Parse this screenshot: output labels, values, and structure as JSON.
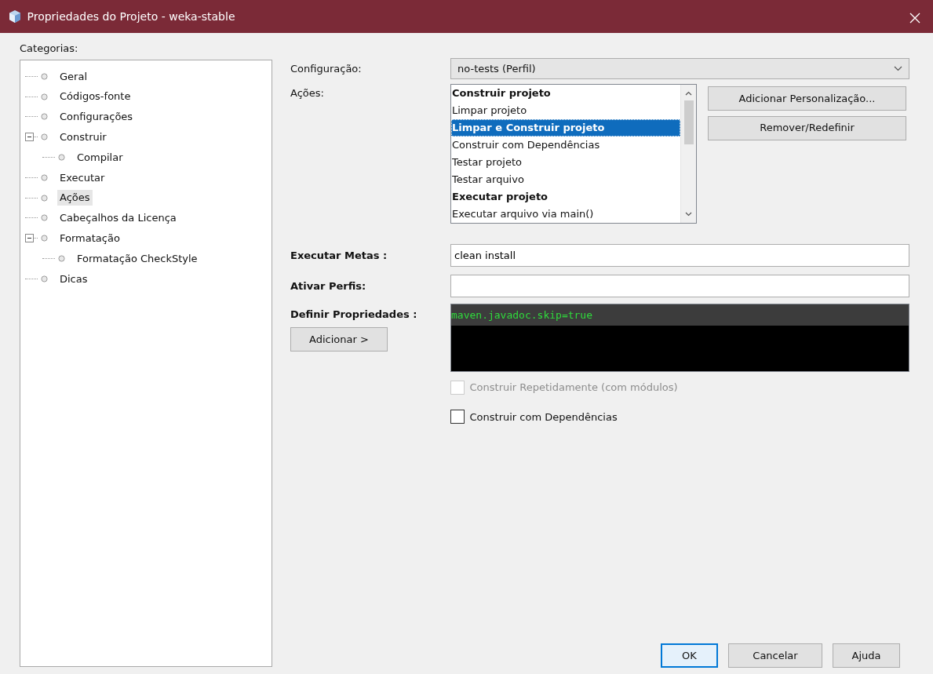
{
  "window": {
    "title": "Propriedades do Projeto - weka-stable"
  },
  "categories": {
    "label": "Categorias:",
    "items": [
      {
        "label": "Geral",
        "selected": false
      },
      {
        "label": "Códigos-fonte",
        "selected": false
      },
      {
        "label": "Configurações",
        "selected": false
      },
      {
        "label": "Construir",
        "selected": false,
        "expanded": true,
        "children": [
          {
            "label": "Compilar",
            "selected": false
          }
        ]
      },
      {
        "label": "Executar",
        "selected": false
      },
      {
        "label": "Ações",
        "selected": true
      },
      {
        "label": "Cabeçalhos da Licença",
        "selected": false
      },
      {
        "label": "Formatação",
        "selected": false,
        "expanded": true,
        "children": [
          {
            "label": "Formatação CheckStyle",
            "selected": false
          }
        ]
      },
      {
        "label": "Dicas",
        "selected": false
      }
    ]
  },
  "configuration": {
    "label": "Configuração:",
    "value": "no-tests (Perfil)"
  },
  "actions": {
    "label": "Ações:",
    "items": [
      {
        "label": "Construir projeto",
        "bold": true,
        "selected": false
      },
      {
        "label": "Limpar projeto",
        "bold": false,
        "selected": false
      },
      {
        "label": "Limpar e Construir projeto",
        "bold": true,
        "selected": true
      },
      {
        "label": "Construir com Dependências",
        "bold": false,
        "selected": false
      },
      {
        "label": "Testar projeto",
        "bold": false,
        "selected": false
      },
      {
        "label": "Testar arquivo",
        "bold": false,
        "selected": false
      },
      {
        "label": "Executar projeto",
        "bold": true,
        "selected": false
      },
      {
        "label": "Executar arquivo via main()",
        "bold": false,
        "selected": false
      }
    ],
    "buttons": [
      "Adicionar Personalização...",
      "Remover/Redefinir"
    ]
  },
  "goals": {
    "label": "Executar Metas :",
    "value": "clean install"
  },
  "profiles": {
    "label": "Ativar Perfis:"
  },
  "properties": {
    "label": "Definir Propriedades :",
    "add_button": "Adicionar >",
    "lines": [
      "maven.javadoc.skip=true"
    ]
  },
  "checkboxes": [
    {
      "label": "Construir Repetidamente (com módulos)",
      "checked": false,
      "disabled": true
    },
    {
      "label": "Construir com Dependências",
      "checked": false,
      "disabled": false
    }
  ],
  "footer_buttons": [
    {
      "label": "OK",
      "default": true
    },
    {
      "label": "Cancelar",
      "default": false
    },
    {
      "label": "Ajuda",
      "default": false
    }
  ]
}
